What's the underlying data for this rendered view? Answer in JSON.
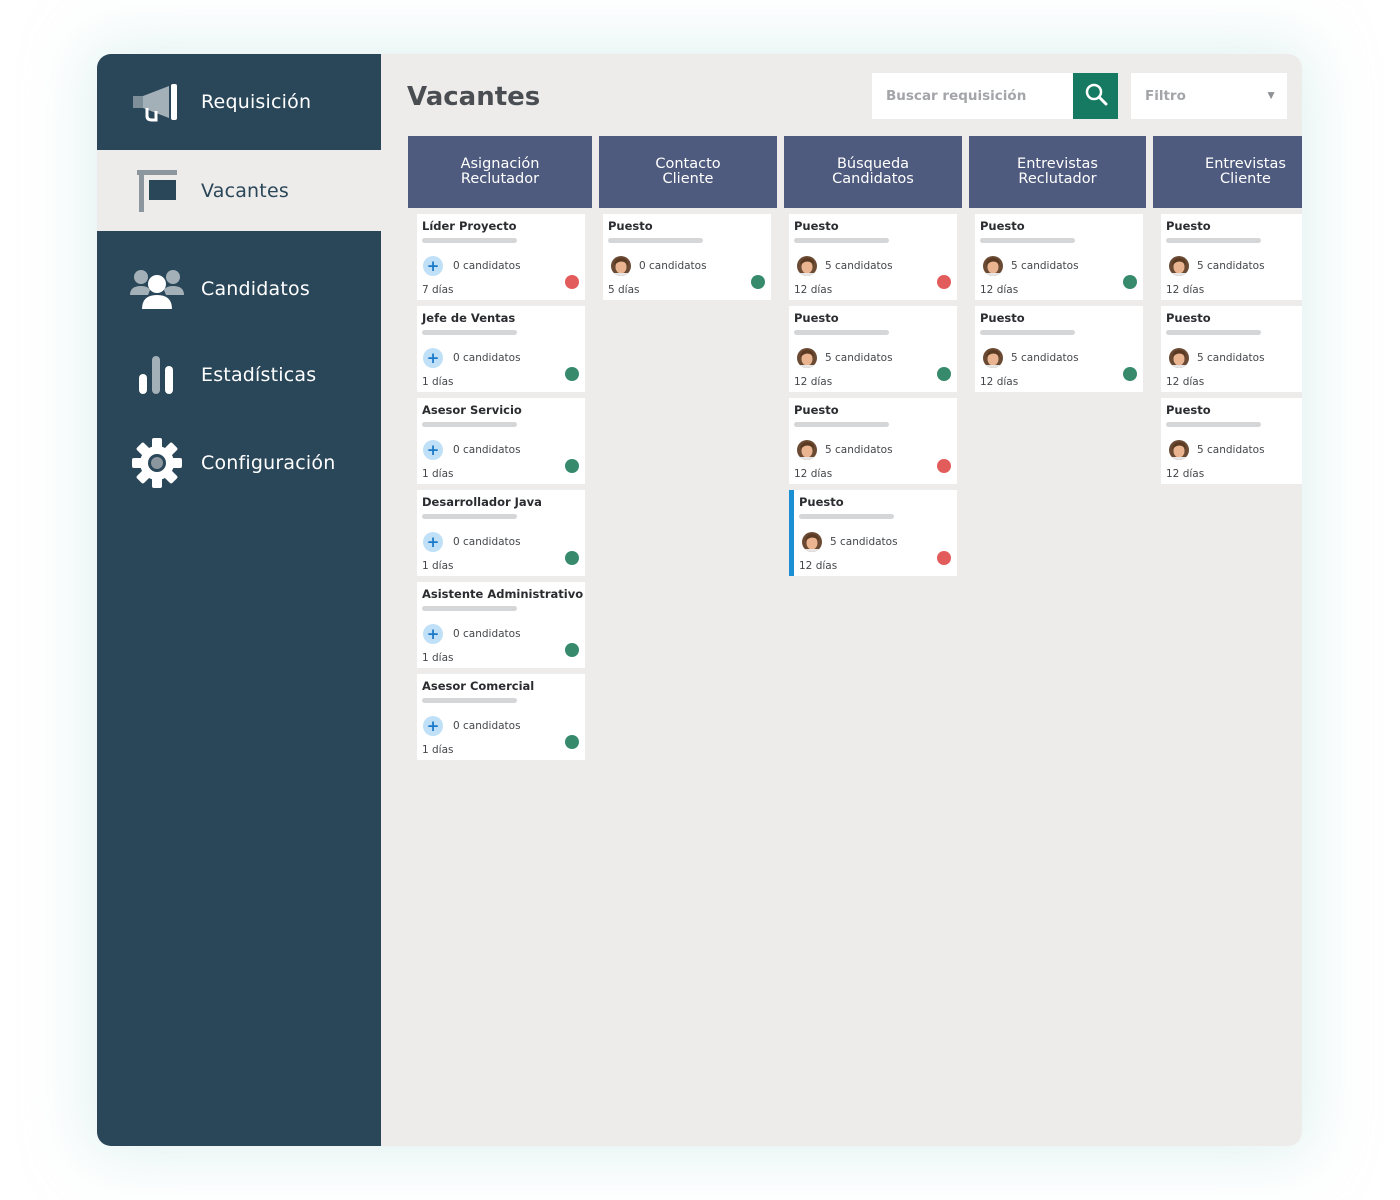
{
  "colors": {
    "sidebar": "#2a4659",
    "green": "#388a6d",
    "red": "#e25c5c",
    "header": "#4f5b7e",
    "accent": "#1a8fd3"
  },
  "sidebar": {
    "items": [
      {
        "label": "Requisición",
        "icon": "megaphone-icon",
        "active": false
      },
      {
        "label": "Vacantes",
        "icon": "flag-icon",
        "active": true
      },
      {
        "label": "Candidatos",
        "icon": "users-icon",
        "active": false
      },
      {
        "label": "Estadísticas",
        "icon": "bar-chart-icon",
        "active": false
      },
      {
        "label": "Configuración",
        "icon": "gear-icon",
        "active": false
      }
    ]
  },
  "header": {
    "title": "Vacantes",
    "search_placeholder": "Buscar requisición",
    "search_icon": "search-icon",
    "filter_label": "Filtro"
  },
  "columns": [
    {
      "title": "Asignación\nReclutador"
    },
    {
      "title": "Contacto\nCliente"
    },
    {
      "title": "Búsqueda\nCandidatos"
    },
    {
      "title": "Entrevistas\nReclutador"
    },
    {
      "title": "Entrevistas\nCliente"
    }
  ],
  "cards": [
    [
      {
        "title": "Líder Proyecto",
        "candidates": "0 candidatos",
        "days": "7 días",
        "status": "red",
        "badge": "plus"
      },
      {
        "title": "Jefe de Ventas",
        "candidates": "0 candidatos",
        "days": "1 días",
        "status": "green",
        "badge": "plus"
      },
      {
        "title": "Asesor Servicio",
        "candidates": "0 candidatos",
        "days": "1 días",
        "status": "green",
        "badge": "plus"
      },
      {
        "title": "Desarrollador Java",
        "candidates": "0 candidatos",
        "days": "1 días",
        "status": "green",
        "badge": "plus"
      },
      {
        "title": "Asistente Administrativo",
        "candidates": "0 candidatos",
        "days": "1 días",
        "status": "green",
        "badge": "plus"
      },
      {
        "title": "Asesor Comercial",
        "candidates": "0 candidatos",
        "days": "1 días",
        "status": "green",
        "badge": "plus"
      }
    ],
    [
      {
        "title": "Puesto",
        "candidates": "0 candidatos",
        "days": "5 días",
        "status": "green",
        "badge": "avatar"
      }
    ],
    [
      {
        "title": "Puesto",
        "candidates": "5 candidatos",
        "days": "12 días",
        "status": "red",
        "badge": "avatar"
      },
      {
        "title": "Puesto",
        "candidates": "5 candidatos",
        "days": "12 días",
        "status": "green",
        "badge": "avatar"
      },
      {
        "title": "Puesto",
        "candidates": "5 candidatos",
        "days": "12 días",
        "status": "red",
        "badge": "avatar"
      },
      {
        "title": "Puesto",
        "candidates": "5 candidatos",
        "days": "12 días",
        "status": "red",
        "badge": "avatar",
        "highlight": true
      }
    ],
    [
      {
        "title": "Puesto",
        "candidates": "5 candidatos",
        "days": "12 días",
        "status": "green",
        "badge": "avatar"
      },
      {
        "title": "Puesto",
        "candidates": "5 candidatos",
        "days": "12 días",
        "status": "green",
        "badge": "avatar"
      }
    ],
    [
      {
        "title": "Puesto",
        "candidates": "5 candidatos",
        "days": "12 días",
        "status": "none",
        "badge": "avatar"
      },
      {
        "title": "Puesto",
        "candidates": "5 candidatos",
        "days": "12 días",
        "status": "none",
        "badge": "avatar"
      },
      {
        "title": "Puesto",
        "candidates": "5 candidatos",
        "days": "12 días",
        "status": "none",
        "badge": "avatar"
      }
    ]
  ]
}
